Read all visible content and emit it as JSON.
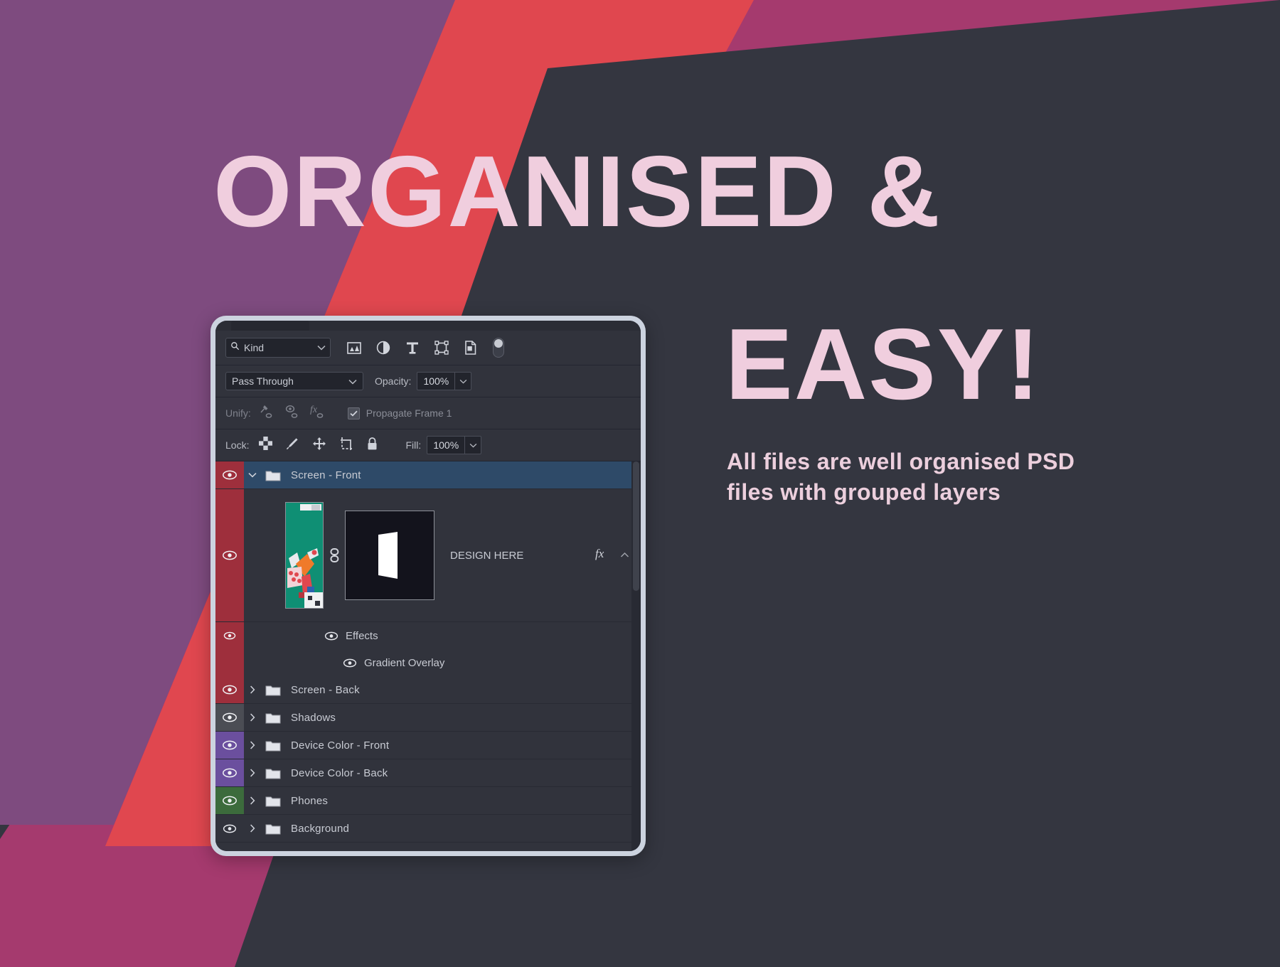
{
  "hero": {
    "headline_line1": "ORGANISED &",
    "headline_line2": "EASY!",
    "subtitle": "All files are well organised PSD files with grouped layers",
    "text_color": "#f0cede"
  },
  "background": {
    "purple": "#7e4b7f",
    "magenta": "#a53a6e",
    "red": "#e0474f",
    "dark": "#343640"
  },
  "panel": {
    "frame_color": "#ccd3df",
    "body_color": "#31333c",
    "filter_row": {
      "search_icon": "search-icon",
      "kind_value": "Kind",
      "dropdown_icon": "chevron-down-icon",
      "icons": [
        "pixel-layer-icon",
        "adjustment-layer-icon",
        "type-layer-icon",
        "shape-layer-icon",
        "smart-object-icon"
      ],
      "toggle_name": "filter-toggle"
    },
    "blend_row": {
      "blend_mode": "Pass Through",
      "opacity_label": "Opacity:",
      "opacity_value": "100%"
    },
    "unify_row": {
      "label": "Unify:",
      "icons": [
        "unify-position-icon",
        "unify-visibility-icon",
        "unify-style-icon"
      ],
      "checkbox_checked": true,
      "propagate_label": "Propagate Frame 1"
    },
    "lock_row": {
      "label": "Lock:",
      "icons": [
        "lock-transparency-icon",
        "lock-image-icon",
        "lock-position-icon",
        "lock-artboard-icon",
        "lock-all-icon"
      ],
      "fill_label": "Fill:",
      "fill_value": "100%"
    },
    "layers": [
      {
        "name": "Screen - Front",
        "type": "group",
        "selected": true,
        "expanded": true,
        "visible": true,
        "color_label": "#9e2f3c",
        "disclosure": "chevron-down-icon"
      },
      {
        "name": "DESIGN HERE",
        "type": "smart-object",
        "selected": false,
        "visible": true,
        "color_label": "#9e2f3c",
        "has_mask": true,
        "has_fx": true,
        "fx_icon": "fx-icon",
        "collapse_icon": "chevron-up-icon",
        "link_icon": "link-icon"
      },
      {
        "name": "Effects",
        "type": "effects-header",
        "visible": true,
        "color_label": "#9e2f3c"
      },
      {
        "name": "Gradient Overlay",
        "type": "effect",
        "visible": true,
        "color_label": "#9e2f3c"
      },
      {
        "name": "Screen - Back",
        "type": "group",
        "selected": false,
        "expanded": false,
        "visible": true,
        "color_label": "#9e2f3c",
        "disclosure": "chevron-right-icon"
      },
      {
        "name": "Shadows",
        "type": "group",
        "selected": false,
        "expanded": false,
        "visible": true,
        "color_label": "#4b4d54",
        "disclosure": "chevron-right-icon"
      },
      {
        "name": "Device Color - Front",
        "type": "group",
        "selected": false,
        "expanded": false,
        "visible": true,
        "color_label": "#6b4f9e",
        "disclosure": "chevron-right-icon"
      },
      {
        "name": "Device Color - Back",
        "type": "group",
        "selected": false,
        "expanded": false,
        "visible": true,
        "color_label": "#6b4f9e",
        "disclosure": "chevron-right-icon"
      },
      {
        "name": "Phones",
        "type": "group",
        "selected": false,
        "expanded": false,
        "visible": true,
        "color_label": "#3c6b3c",
        "disclosure": "chevron-right-icon"
      },
      {
        "name": "Background",
        "type": "group",
        "selected": false,
        "expanded": false,
        "visible": true,
        "color_label": "none",
        "disclosure": "chevron-right-icon"
      }
    ]
  }
}
